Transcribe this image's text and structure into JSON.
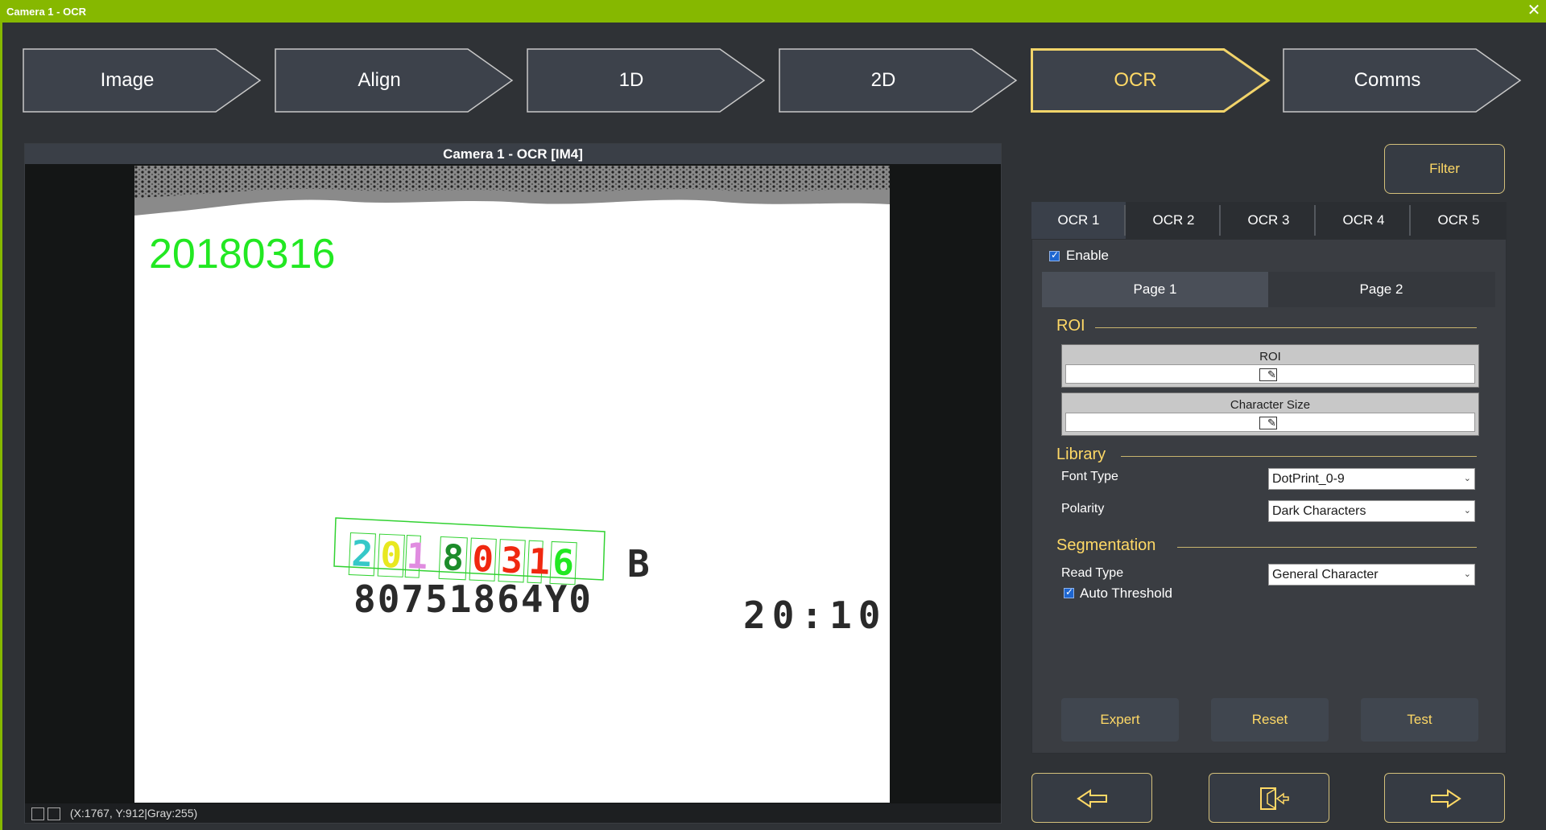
{
  "window": {
    "title": "Camera 1 - OCR",
    "close_icon": "close-icon"
  },
  "steps": [
    {
      "label": "Image",
      "active": false
    },
    {
      "label": "Align",
      "active": false
    },
    {
      "label": "1D",
      "active": false
    },
    {
      "label": "2D",
      "active": false
    },
    {
      "label": "OCR",
      "active": true
    },
    {
      "label": "Comms",
      "active": false
    }
  ],
  "viewer": {
    "title": "Camera 1 - OCR  [IM4]",
    "ocr_result": "20180316",
    "status": "(X:1767, Y:912|Gray:255)",
    "image_text": {
      "line1_read": [
        "2",
        "0",
        "1",
        "8",
        "0",
        "3",
        "1",
        "6"
      ],
      "line1_suffix": "B",
      "line2": "80751864Y0",
      "line2_right": "20:10"
    }
  },
  "filter_button": "Filter",
  "ocr_tabs": [
    {
      "label": "OCR 1",
      "active": true
    },
    {
      "label": "OCR 2",
      "active": false
    },
    {
      "label": "OCR 3",
      "active": false
    },
    {
      "label": "OCR 4",
      "active": false
    },
    {
      "label": "OCR 5",
      "active": false
    }
  ],
  "panel": {
    "enable_label": "Enable",
    "enable_checked": true,
    "pages": [
      {
        "label": "Page 1",
        "active": true
      },
      {
        "label": "Page 2",
        "active": false
      }
    ],
    "roi_section": "ROI",
    "roi_label": "ROI",
    "char_size_label": "Character Size",
    "library_section": "Library",
    "font_type_label": "Font Type",
    "font_type_value": "DotPrint_0-9",
    "polarity_label": "Polarity",
    "polarity_value": "Dark Characters",
    "segmentation_section": "Segmentation",
    "read_type_label": "Read Type",
    "read_type_value": "General Character",
    "auto_threshold_label": "Auto Threshold",
    "auto_threshold_checked": true,
    "buttons": {
      "expert": "Expert",
      "reset": "Reset",
      "test": "Test"
    }
  },
  "nav": {
    "prev_icon": "arrow-left-icon",
    "exit_icon": "exit-icon",
    "next_icon": "arrow-right-icon"
  },
  "colors": {
    "accent": "#ffd966",
    "titlebar": "#86b800",
    "ocr_green": "#22e822"
  }
}
